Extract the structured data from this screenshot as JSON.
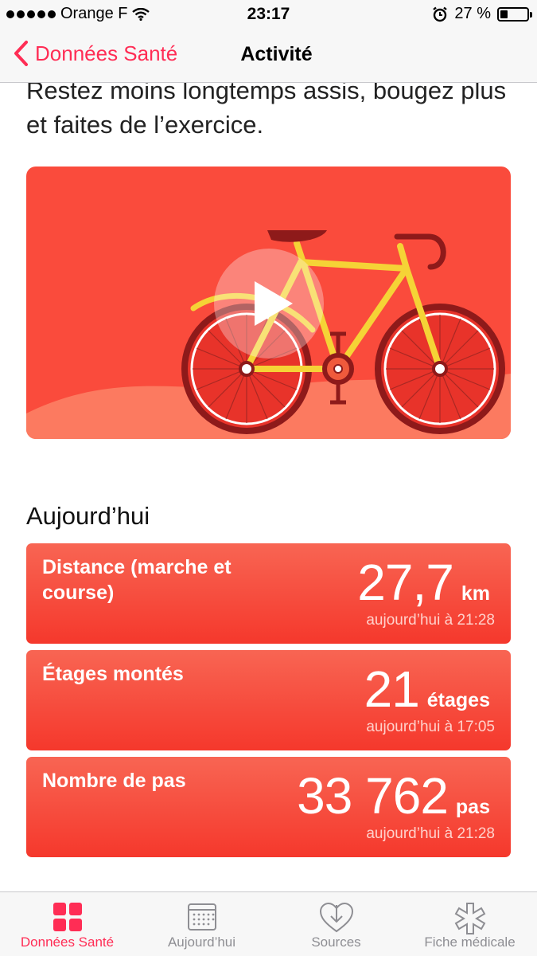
{
  "status": {
    "carrier": "Orange F",
    "time": "23:17",
    "battery": "27 %"
  },
  "nav": {
    "back_label": "Données Santé",
    "title": "Activité"
  },
  "intro": {
    "text": "Restez moins longtemps assis, bougez plus et faites de l’exercice."
  },
  "section": {
    "title": "Aujourd’hui"
  },
  "cards": [
    {
      "label": "Distance (marche et course)",
      "value": "27,7",
      "unit": "km",
      "time": "aujourd’hui à 21:28"
    },
    {
      "label": "Étages montés",
      "value": "21",
      "unit": "étages",
      "time": "aujourd’hui à 17:05"
    },
    {
      "label": "Nombre de pas",
      "value": "33 762",
      "unit": "pas",
      "time": "aujourd’hui à 21:28"
    }
  ],
  "tabs": [
    {
      "label": "Données Santé",
      "icon": "grid-icon",
      "active": true
    },
    {
      "label": "Aujourd’hui",
      "icon": "calendar-icon",
      "active": false
    },
    {
      "label": "Sources",
      "icon": "heart-download-icon",
      "active": false
    },
    {
      "label": "Fiche médicale",
      "icon": "medical-star-icon",
      "active": false
    }
  ],
  "colors": {
    "accent": "#ff2d55",
    "card": "#f5472f",
    "bike_frame": "#f5d336",
    "video_bg": "#fa4b3c"
  }
}
